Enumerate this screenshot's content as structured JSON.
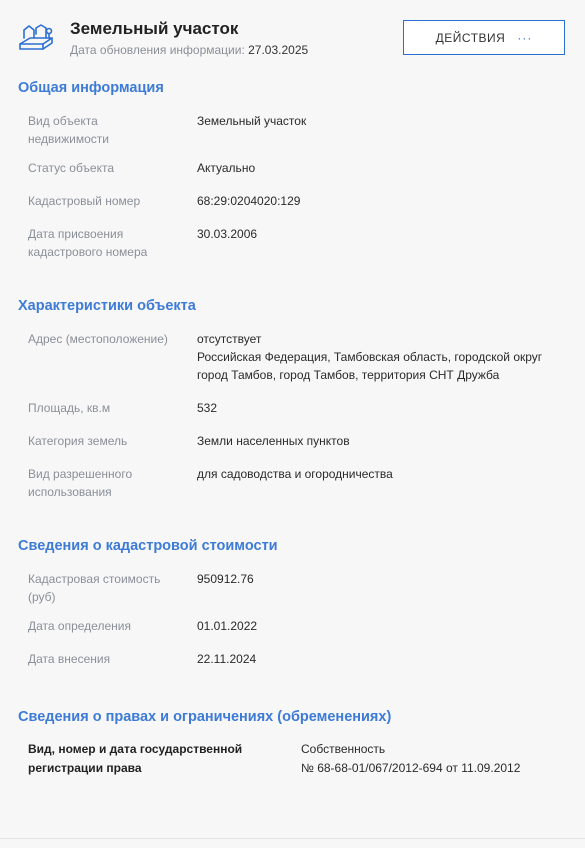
{
  "header": {
    "title": "Земельный участок",
    "updated_label": "Дата обновления информации:",
    "updated_value": "27.03.2025",
    "actions_label": "ДЕЙСТВИЯ",
    "actions_dots": "···",
    "logo_icon": "land-plot-icon"
  },
  "general": {
    "title": "Общая информация",
    "rows": [
      {
        "label_1": "Вид объекта",
        "label_2": "недвижимости",
        "value": "Земельный участок"
      },
      {
        "label": "Статус объекта",
        "value": "Актуально"
      },
      {
        "label": "Кадастровый номер",
        "value": "68:29:0204020:129"
      },
      {
        "label_1": "Дата присвоения",
        "label_2": "кадастрового номера",
        "value": "30.03.2006"
      }
    ]
  },
  "characteristics": {
    "title": "Характеристики объекта",
    "address_label": "Адрес (местоположение)",
    "address_value_1": "отсутствует",
    "address_value_2": "Российская Федерация, Тамбовская область, городской округ",
    "address_value_3": "город Тамбов, город Тамбов, территория СНТ Дружба",
    "area_label": "Площадь, кв.м",
    "area_value": "532",
    "category_label": "Категория земель",
    "category_value": "Земли населенных пунктов",
    "use_label_1": "Вид разрешенного",
    "use_label_2": "использования",
    "use_value": "для садоводства и огородничества"
  },
  "cadastral": {
    "title": "Сведения о кадастровой стоимости",
    "cost_label_1": "Кадастровая стоимость",
    "cost_label_2": "(руб)",
    "cost_value": "950912.76",
    "determined_label": "Дата определения",
    "determined_value": "01.01.2022",
    "entered_label": "Дата внесения",
    "entered_value": "22.11.2024"
  },
  "rights": {
    "title": "Сведения о правах и ограничениях (обременениях)",
    "label_1": "Вид, номер и дата государственной",
    "label_2": "регистрации права",
    "value_1": "Собственность",
    "value_2": "№ 68-68-01/067/2012-694 от 11.09.2012"
  },
  "colors": {
    "accent": "#3d7bd6",
    "button_border": "#2c6fd3",
    "muted_text": "#8a8f98",
    "background": "#f7f7f8"
  }
}
